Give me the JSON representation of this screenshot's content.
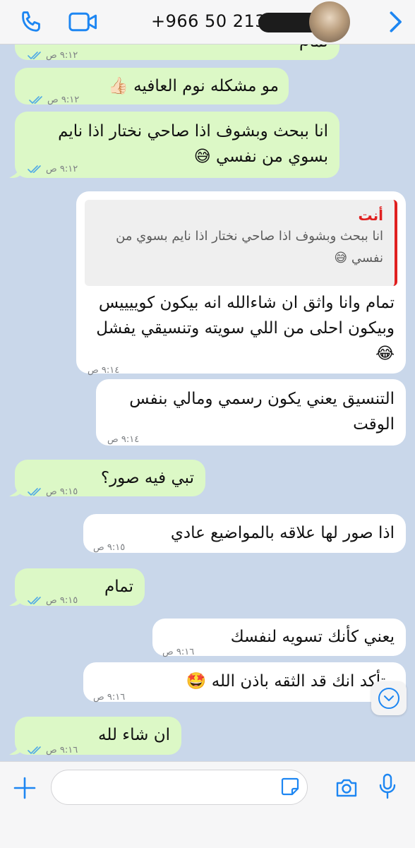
{
  "header": {
    "contact_name": "+966 50 213",
    "phone_icon": "phone-icon",
    "video_icon": "video-icon",
    "back_icon": "chevron-right-icon"
  },
  "messages": [
    {
      "direction": "out",
      "text": "تمام",
      "time": "٩:١٢ ص",
      "ticks": "read"
    },
    {
      "direction": "out",
      "text": "مو مشكله نوم العافيه 👍🏻",
      "time": "٩:١٢ ص",
      "ticks": "read"
    },
    {
      "direction": "out",
      "lines": [
        "انا ببحث وبشوف اذا صاحي نختار اذا نايم",
        "بسوي من نفسي 😅"
      ],
      "time": "٩:١٢ ص",
      "ticks": "read"
    },
    {
      "direction": "in",
      "quote": {
        "author": "أنت",
        "lines": [
          "انا ببحث وبشوف اذا صاحي نختار اذا نايم بسوي من",
          "نفسي 😅"
        ]
      },
      "lines": [
        "تمام وانا واثق ان شاءالله انه بيكون كوييييس",
        "وبيكون احلى من اللي سويته وتنسيقي يفشل",
        "😂"
      ],
      "time": "٩:١٤ ص"
    },
    {
      "direction": "in",
      "lines": [
        "التنسيق يعني يكون رسمي ومالي بنفس",
        "الوقت"
      ],
      "time": "٩:١٤ ص"
    },
    {
      "direction": "out",
      "text": "تبي فيه صور؟",
      "time": "٩:١٥ ص",
      "ticks": "read"
    },
    {
      "direction": "in",
      "text": "اذا صور لها علاقه بالمواضيع عادي",
      "time": "٩:١٥ ص"
    },
    {
      "direction": "out",
      "text": "تمام",
      "time": "٩:١٥ ص",
      "ticks": "read"
    },
    {
      "direction": "in",
      "text": "يعني كأنك تسويه لنفسك",
      "time": "٩:١٦ ص"
    },
    {
      "direction": "in",
      "text": "متأكد انك قد الثقه باذن الله 🤩",
      "time": "٩:١٦ ص"
    },
    {
      "direction": "out",
      "text": "ان شاء لله",
      "time": "٩:١٦ ص",
      "ticks": "read"
    }
  ],
  "scroll_down_icon": "chevron-down-circle-icon",
  "input_bar": {
    "placeholder": "",
    "icons": [
      "plus-icon",
      "sticker-icon",
      "camera-icon",
      "microphone-icon"
    ]
  },
  "colors": {
    "accent": "#1d86f2",
    "outgoing_bubble": "#dcf8c6",
    "incoming_bubble": "#ffffff",
    "chat_background": "#c9d7ea",
    "read_ticks": "#4fa9e6",
    "quote_bar": "#e02020"
  }
}
